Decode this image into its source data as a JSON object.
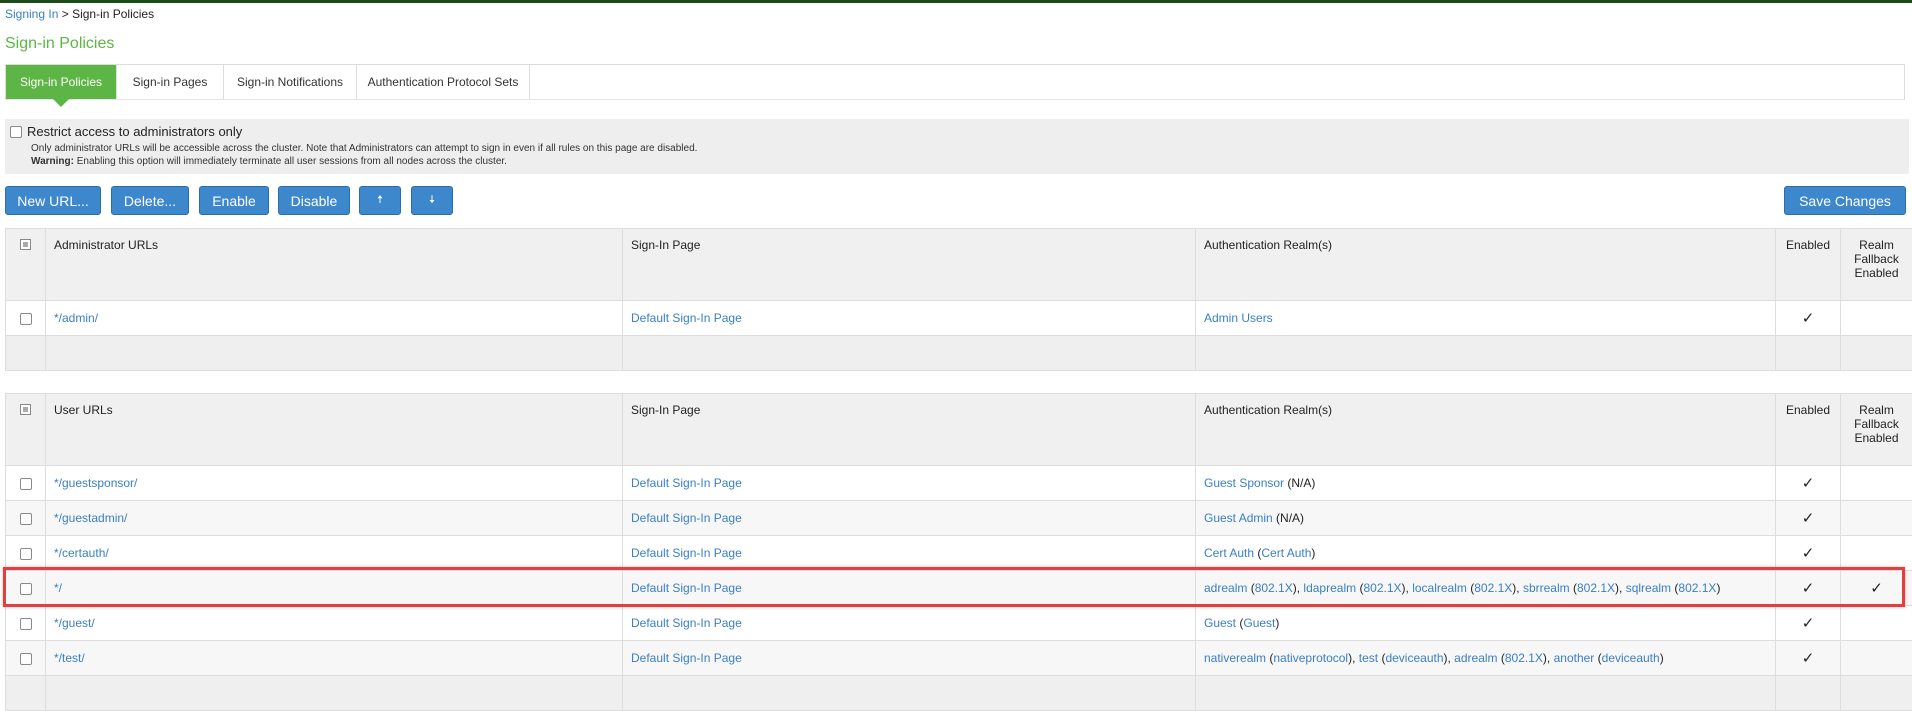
{
  "breadcrumb": {
    "parent": "Signing In",
    "separator": " > ",
    "current": "Sign-in Policies"
  },
  "page_title": "Sign-in Policies",
  "tabs": [
    {
      "label": "Sign-in Policies",
      "active": true
    },
    {
      "label": "Sign-in Pages",
      "active": false
    },
    {
      "label": "Sign-in Notifications",
      "active": false
    },
    {
      "label": "Authentication Protocol Sets",
      "active": false
    }
  ],
  "restrict": {
    "label": "Restrict access to administrators only",
    "note": "Only administrator URLs will be accessible across the cluster. Note that Administrators can attempt to sign in even if all rules on this page are disabled.",
    "warning_label": "Warning:",
    "warning_text": " Enabling this option will immediately terminate all user sessions from all nodes across the cluster."
  },
  "toolbar": {
    "new_url": "New URL...",
    "delete": "Delete...",
    "enable": "Enable",
    "disable": "Disable",
    "move_up": "🠅",
    "move_down": "🠇",
    "save_changes": "Save Changes"
  },
  "admin_table": {
    "headers": {
      "urls": "Administrator URLs",
      "page": "Sign-In Page",
      "realms": "Authentication Realm(s)",
      "enabled": "Enabled",
      "fallback": "Realm Fallback Enabled"
    },
    "rows": [
      {
        "url": "*/admin/",
        "page": "Default Sign-In Page",
        "realm": "Admin Users",
        "enabled": "✓",
        "fallback": ""
      }
    ]
  },
  "user_table": {
    "headers": {
      "urls": "User URLs",
      "page": "Sign-In Page",
      "realms": "Authentication Realm(s)",
      "enabled": "Enabled",
      "fallback": "Realm Fallback Enabled"
    },
    "rows": [
      {
        "url": "*/guestsponsor/",
        "page": "Default Sign-In Page",
        "realm_link": "Guest Sponsor",
        "realm_suffix": " (N/A)",
        "enabled": "✓",
        "fallback": ""
      },
      {
        "url": "*/guestadmin/",
        "page": "Default Sign-In Page",
        "realm_link": "Guest Admin",
        "realm_suffix": " (N/A)",
        "enabled": "✓",
        "fallback": ""
      },
      {
        "url": "*/certauth/",
        "page": "Default Sign-In Page",
        "realm_link": "Cert Auth",
        "realm_open": " (",
        "realm_proto": "Cert Auth",
        "realm_close": ")",
        "enabled": "✓",
        "fallback": ""
      },
      {
        "url": "*/",
        "page": "Default Sign-In Page",
        "realms": [
          {
            "name": "adrealm",
            "proto": "802.1X"
          },
          {
            "name": "ldaprealm",
            "proto": "802.1X"
          },
          {
            "name": "localrealm",
            "proto": "802.1X"
          },
          {
            "name": "sbrrealm",
            "proto": "802.1X"
          },
          {
            "name": "sqlrealm",
            "proto": "802.1X"
          }
        ],
        "enabled": "✓",
        "fallback": "✓"
      },
      {
        "url": "*/guest/",
        "page": "Default Sign-In Page",
        "realm_link": "Guest",
        "realm_open": " (",
        "realm_proto": "Guest",
        "realm_close": ")",
        "enabled": "✓",
        "fallback": ""
      },
      {
        "url": "*/test/",
        "page": "Default Sign-In Page",
        "realms": [
          {
            "name": "nativerealm",
            "proto": "nativeprotocol"
          },
          {
            "name": "test",
            "proto": "deviceauth"
          },
          {
            "name": "adrealm",
            "proto": "802.1X"
          },
          {
            "name": "another",
            "proto": "deviceauth"
          }
        ],
        "enabled": "✓",
        "fallback": ""
      }
    ]
  },
  "colors": {
    "accent_green": "#5cb544",
    "button_blue": "#3d87cc",
    "link_blue": "#3a7fc4",
    "highlight_red": "#e04040"
  }
}
